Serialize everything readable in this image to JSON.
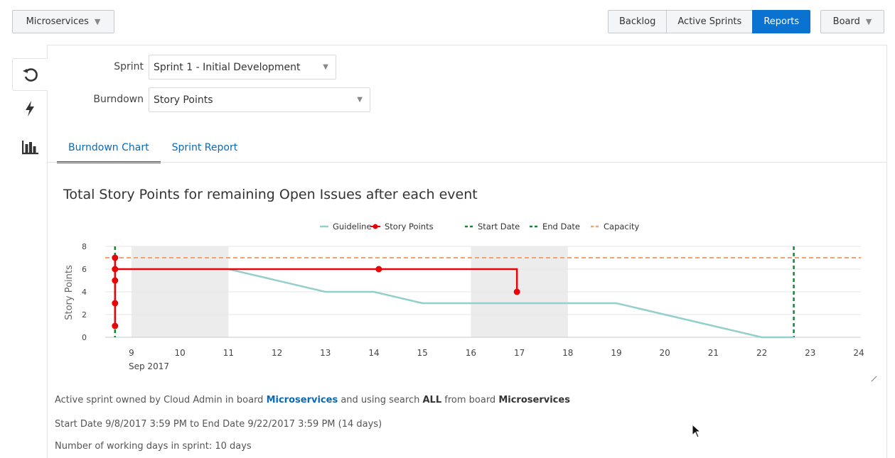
{
  "toolbar": {
    "board_select": "Microservices",
    "nav": [
      "Backlog",
      "Active Sprints",
      "Reports"
    ],
    "nav_active": "Reports",
    "board_menu": "Board"
  },
  "sidebar": {
    "items": [
      {
        "icon": "refresh-icon"
      },
      {
        "icon": "lightning-icon"
      },
      {
        "icon": "bar-chart-icon"
      }
    ]
  },
  "filters": {
    "sprint_label": "Sprint",
    "sprint_value": "Sprint 1 - Initial Development",
    "burndown_label": "Burndown",
    "burndown_value": "Story Points"
  },
  "tabs": [
    "Burndown Chart",
    "Sprint Report"
  ],
  "colors": {
    "accent": "#0a73d1",
    "guideline": "#93cfcb",
    "story_points": "#e6060a",
    "start_end_date": "#0e8a2e",
    "capacity": "#f0a272",
    "non_working": "#ececec"
  },
  "chart_data": {
    "type": "line",
    "title": "Total Story Points for remaining Open Issues after each event",
    "xlabel": "",
    "ylabel": "Story Points",
    "x_range": [
      "2017-09-08",
      "2017-09-24"
    ],
    "ylim": [
      0,
      8
    ],
    "y_ticks": [
      0,
      2,
      4,
      6,
      8
    ],
    "x_ticks": [
      "9",
      "10",
      "11",
      "12",
      "13",
      "14",
      "15",
      "16",
      "17",
      "18",
      "19",
      "20",
      "21",
      "22",
      "23",
      "24"
    ],
    "x_tick_days": [
      9,
      10,
      11,
      12,
      13,
      14,
      15,
      16,
      17,
      18,
      19,
      20,
      21,
      22,
      23,
      24
    ],
    "x_sublabel": "Sep 2017",
    "legend": [
      "Guideline",
      "Story Points",
      "Start Date",
      "End Date",
      "Capacity"
    ],
    "legend_position": "top-center",
    "grid": true,
    "non_working_days": [
      [
        9,
        11
      ],
      [
        16,
        18
      ]
    ],
    "series": [
      {
        "name": "Guideline",
        "points": [
          [
            8.66,
            6
          ],
          [
            11,
            6
          ],
          [
            13,
            4
          ],
          [
            14,
            4
          ],
          [
            15,
            3
          ],
          [
            19,
            3
          ],
          [
            22,
            0
          ],
          [
            22.66,
            0
          ]
        ]
      },
      {
        "name": "Story Points",
        "points": [
          [
            8.66,
            1
          ],
          [
            8.66,
            3
          ],
          [
            8.66,
            5
          ],
          [
            8.66,
            6
          ],
          [
            8.66,
            7
          ],
          [
            8.66,
            6
          ],
          [
            14.1,
            6
          ],
          [
            16.95,
            6
          ],
          [
            16.95,
            4
          ]
        ],
        "markers": [
          [
            8.66,
            1
          ],
          [
            8.66,
            3
          ],
          [
            8.66,
            5
          ],
          [
            8.66,
            6
          ],
          [
            8.66,
            7
          ],
          [
            14.1,
            6
          ],
          [
            16.95,
            4
          ]
        ]
      }
    ],
    "start_date": 8.66,
    "end_date": 22.66,
    "capacity": 7
  },
  "info": {
    "line1_prefix": "Active sprint owned by Cloud Admin in board ",
    "line1_board": "Microservices",
    "line1_mid": " and using search ",
    "line1_search": "ALL",
    "line1_mid2": " from board ",
    "line1_board2": "Microservices",
    "line2": "Start Date 9/8/2017 3:59 PM to End Date 9/22/2017 3:59 PM (14 days)",
    "line3": "Number of working days in sprint: 10 days"
  }
}
